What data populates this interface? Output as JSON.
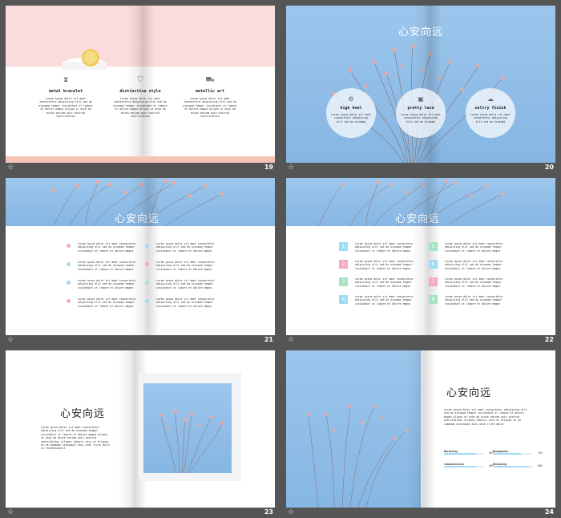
{
  "footer_icon": "☆",
  "colors": {
    "pink": "#fbdcdc",
    "salmon": "#f6c4b6",
    "sky": "#8fbde8",
    "dot_pink": "#f4a9c9",
    "dot_green": "#a6e2c2",
    "dot_blue": "#9fdcf3"
  },
  "lorem3": "Lorem ipsum dolor sit amet consectetur adipiscing elit sed do eiusmod tempor incididunt ut labore",
  "slides": {
    "s19": {
      "number": "19",
      "cols": [
        {
          "icon": "hourglass-icon",
          "glyph": "⧗",
          "title": "metal bracelet",
          "text": "Lorem ipsum dolor sit amet consectetur adipiscing elit sed do eiusmod tempor incididunt ut labore et dolore magna aliqua ut enim ad minim veniam quis nostrud exercitation"
        },
        {
          "icon": "shield-icon",
          "glyph": "⛉",
          "title": "distinctive style",
          "text": "Lorem ipsum dolor sit amet consectetur adipiscing elit sed do eiusmod tempor incididunt ut labore et dolore magna aliqua ut enim ad minim veniam quis nostrud exercitation"
        },
        {
          "icon": "car-icon",
          "glyph": "⛟",
          "title": "metallic art",
          "text": "Lorem ipsum dolor sit amet consectetur adipiscing elit sed do eiusmod tempor incididunt ut labore et dolore magna aliqua ut enim ad minim veniam quis nostrud exercitation"
        }
      ]
    },
    "s20": {
      "number": "20",
      "title": "心安向远",
      "circles": [
        {
          "icon": "gear-icon",
          "glyph": "⚙",
          "title": "high heel",
          "text": "Lorem ipsum dolor sit amet consectetur adipiscing elit sed do eiusmod"
        },
        {
          "icon": "camera-icon",
          "glyph": "▣",
          "title": "pretty lace",
          "text": "Lorem ipsum dolor sit amet consectetur adipiscing elit sed do eiusmod"
        },
        {
          "icon": "cloud-icon",
          "glyph": "☁",
          "title": "sultry finish",
          "text": "Lorem ipsum dolor sit amet consectetur adipiscing elit sed do eiusmod"
        }
      ]
    },
    "s21": {
      "number": "21",
      "title": "心安向远",
      "text": "Lorem ipsum dolor sit amet consectetur adipiscing elit sed do eiusmod tempor incididunt ut labore et dolore magna"
    },
    "s22": {
      "number": "22",
      "title": "心安向远",
      "nums": [
        "1",
        "2",
        "3",
        "4",
        "5",
        "6",
        "7",
        "8"
      ],
      "text": "Lorem ipsum dolor sit amet consectetur adipiscing elit sed do eiusmod tempor incididunt ut labore et dolore magna"
    },
    "s23": {
      "number": "23",
      "title": "心安向远",
      "text": "Lorem ipsum dolor sit amet consectetur adipiscing elit sed do eiusmod tempor incididunt ut labore et dolore magna aliqua ut enim ad minim veniam quis nostrud exercitation ullamco laboris nisi ut aliquip ex ea commodo consequat duis aute irure dolor in reprehenderit"
    },
    "s24": {
      "number": "24",
      "title": "心安向远",
      "text": "Lorem ipsum dolor sit amet consectetur adipiscing elit sed do eiusmod tempor incididunt ut labore et dolore magna aliqua ut enim ad minim veniam quis nostrud exercitation ullamco laboris nisi ut aliquip ex ea commodo consequat duis aute irure dolor",
      "bars": [
        {
          "label": "Marketing",
          "value": "80%",
          "pct": 0.8
        },
        {
          "label": "Management",
          "value": "70%",
          "pct": 0.7
        },
        {
          "label": "Communication",
          "value": "80%",
          "pct": 0.8
        },
        {
          "label": "Designing",
          "value": "90%",
          "pct": 0.9
        }
      ]
    }
  }
}
